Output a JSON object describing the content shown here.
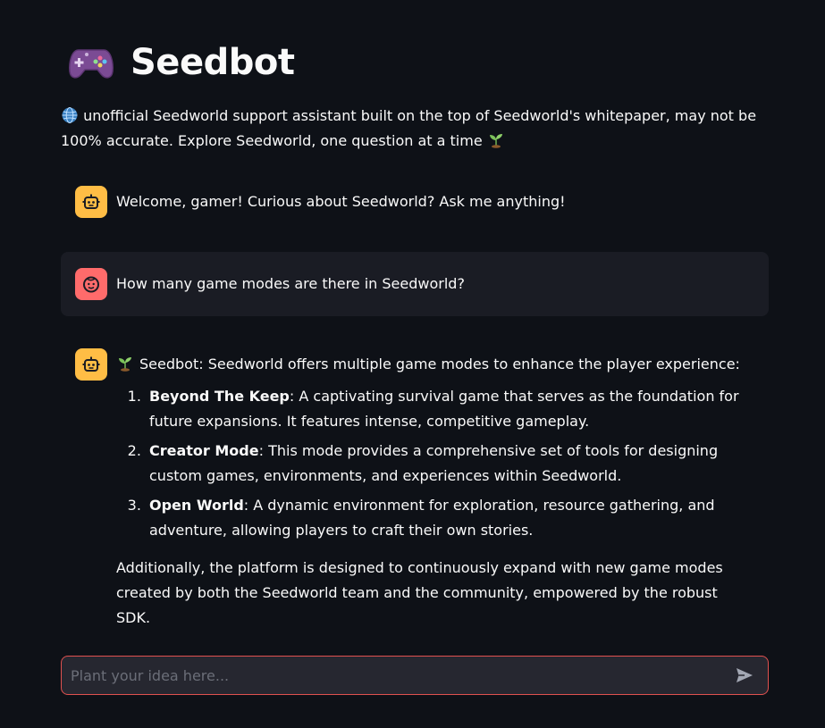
{
  "header": {
    "title": "Seedbot",
    "logo_icon": "game-controller-icon"
  },
  "subtitle": {
    "text": "unofficial Seedworld support assistant built on the top of Seedworld's whitepaper, may not be 100% accurate. Explore Seedworld, one question at a time",
    "lead_icon": "globe-icon",
    "trail_icon": "sprout-icon"
  },
  "messages": [
    {
      "role": "assistant",
      "avatar_icon": "bot-icon",
      "text": "Welcome, gamer! Curious about Seedworld? Ask me anything!"
    },
    {
      "role": "user",
      "avatar_icon": "user-face-icon",
      "text": "How many game modes are there in Seedworld?"
    },
    {
      "role": "assistant",
      "avatar_icon": "bot-icon",
      "intro": "Seedbot: Seedworld offers multiple game modes to enhance the player experience:",
      "modes": [
        {
          "name": "Beyond The Keep",
          "description": ": A captivating survival game that serves as the foundation for future expansions. It features intense, competitive gameplay."
        },
        {
          "name": "Creator Mode",
          "description": ": This mode provides a comprehensive set of tools for designing custom games, environments, and experiences within Seedworld."
        },
        {
          "name": "Open World",
          "description": ": A dynamic environment for exploration, resource gathering, and adventure, allowing players to craft their own stories."
        }
      ],
      "outro": "Additionally, the platform is designed to continuously expand with new game modes created by both the Seedworld team and the community, empowered by the robust SDK."
    }
  ],
  "input": {
    "placeholder": "Plant your idea here...",
    "value": ""
  },
  "colors": {
    "background": "#0e1117",
    "bot_avatar": "#ffbd45",
    "user_avatar": "#ff6b6b",
    "input_border": "#e0514f",
    "user_message_bg": "#1a1c24"
  }
}
